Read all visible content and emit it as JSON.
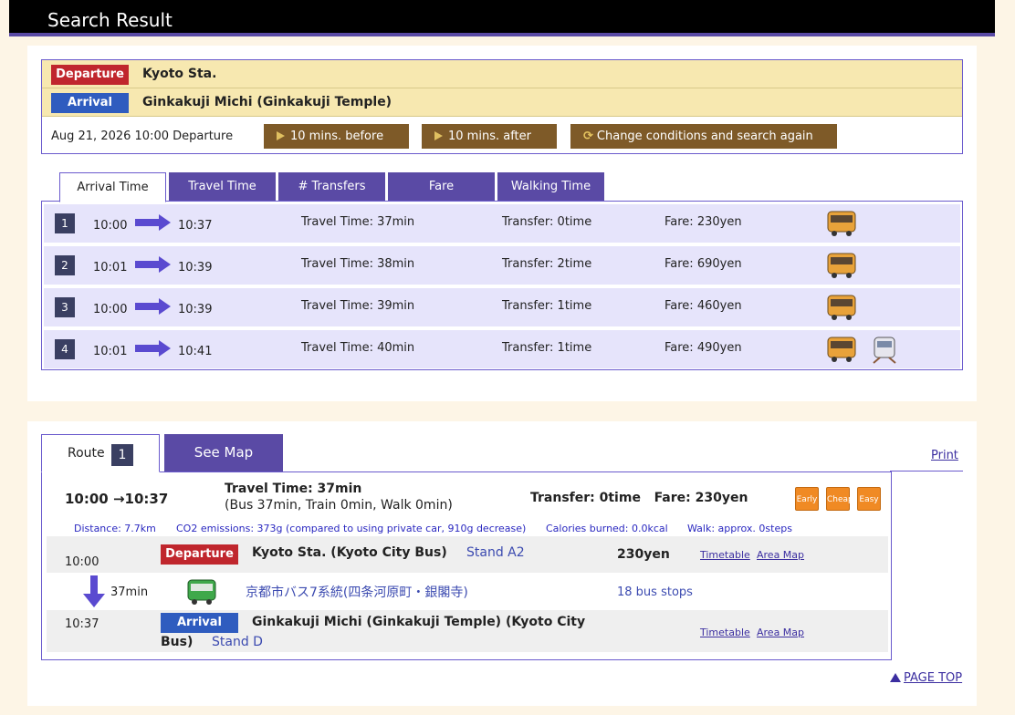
{
  "header": {
    "title": "Search Result"
  },
  "conditions": {
    "departure_label": "Departure",
    "departure_name": "Kyoto Sta.",
    "arrival_label": "Arrival",
    "arrival_name": "Ginkakuji Michi (Ginkakuji Temple)",
    "datetime": "Aug 21, 2026 10:00 Departure",
    "btn_before": "10 mins. before",
    "btn_after": "10 mins. after",
    "btn_change": "Change conditions and search again"
  },
  "sort_tabs": [
    "Arrival Time",
    "Travel Time",
    "# Transfers",
    "Fare",
    "Walking Time"
  ],
  "results": [
    {
      "num": "1",
      "dep": "10:00",
      "arr": "10:37",
      "travel": "Travel Time: 37min",
      "transfer": "Transfer: 0time",
      "fare": "Fare: 230yen",
      "icons": [
        "bus-icon"
      ]
    },
    {
      "num": "2",
      "dep": "10:01",
      "arr": "10:39",
      "travel": "Travel Time: 38min",
      "transfer": "Transfer: 2time",
      "fare": "Fare: 690yen",
      "icons": [
        "bus-icon"
      ]
    },
    {
      "num": "3",
      "dep": "10:00",
      "arr": "10:39",
      "travel": "Travel Time: 39min",
      "transfer": "Transfer: 1time",
      "fare": "Fare: 460yen",
      "icons": [
        "bus-icon"
      ]
    },
    {
      "num": "4",
      "dep": "10:01",
      "arr": "10:41",
      "travel": "Travel Time: 40min",
      "transfer": "Transfer: 1time",
      "fare": "Fare: 490yen",
      "icons": [
        "bus-icon",
        "train-icon"
      ]
    }
  ],
  "route_tabs": {
    "route_label": "Route",
    "route_num": "1",
    "map_label": "See Map",
    "print": "Print"
  },
  "route": {
    "times": "10:00 →10:37",
    "travel_time": "Travel Time: 37min",
    "breakdown": "(Bus 37min, Train 0min, Walk 0min)",
    "transfer_fare": "Transfer: 0time   Fare: 230yen",
    "tags": [
      "Early",
      "Cheap",
      "Easy"
    ],
    "distance": "Distance: 7.7km",
    "co2": "CO2 emissions: 373g (compared to using private car, 910g decrease)",
    "calories": "Calories burned: 0.0kcal",
    "walk": "Walk: approx. 0steps",
    "dep_time": "10:00",
    "dep_label": "Departure",
    "dep_name": "Kyoto Sta. (Kyoto City Bus)",
    "dep_stand": "Stand A2",
    "dep_fare": "230yen",
    "timetable": "Timetable",
    "area_map": "Area Map",
    "duration": "37min",
    "line_name": "京都市バス7系統(四条河原町・銀閣寺)",
    "stops": "18 bus stops",
    "arr_time": "10:37",
    "arr_label": "Arrival",
    "arr_name_1": "Ginkakuji Michi (Ginkakuji Temple) (Kyoto City",
    "arr_name_2": "Bus)",
    "arr_stand": "Stand D"
  },
  "page_top": "PAGE TOP",
  "colors": {
    "accent": "#5a4aa5",
    "departure": "#c0262d",
    "arrival": "#2f5cbf",
    "brown_button": "#7e5a28",
    "tag": "#f08a24"
  }
}
